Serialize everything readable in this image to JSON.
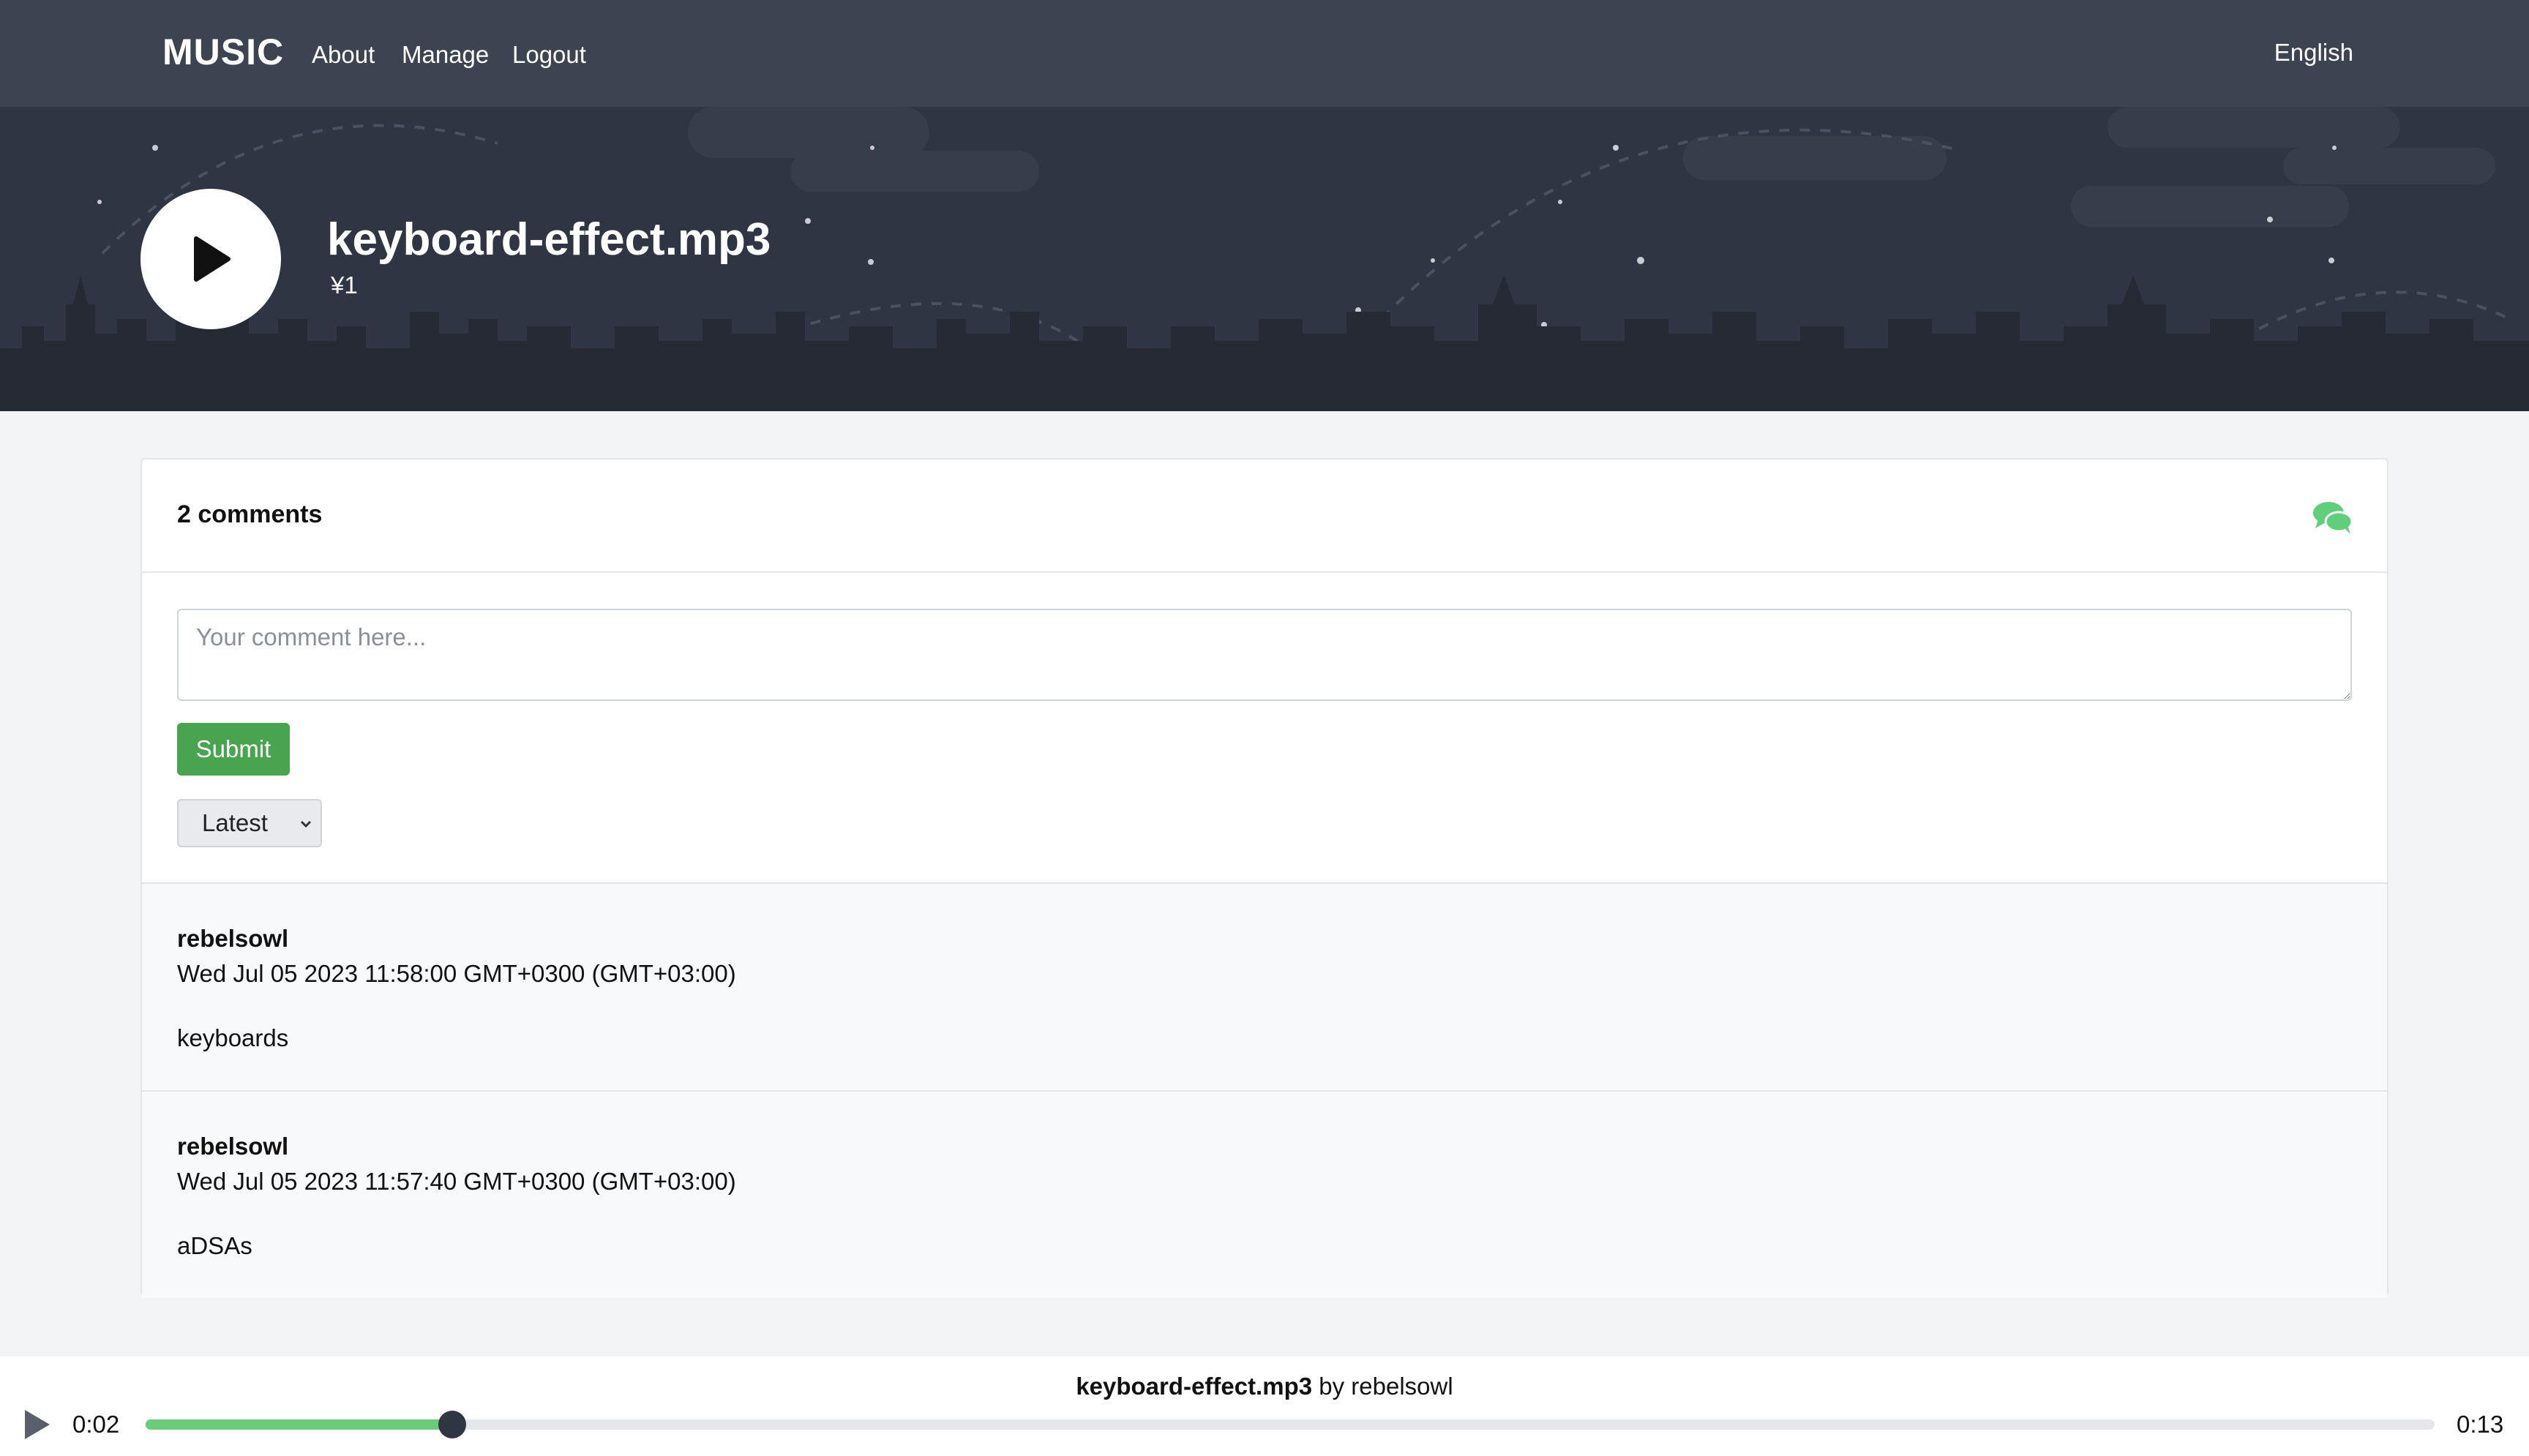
{
  "nav": {
    "brand": "MUSIC",
    "links": [
      "About",
      "Manage",
      "Logout"
    ],
    "language": "English"
  },
  "hero": {
    "title": "keyboard-effect.mp3",
    "price": "¥1"
  },
  "comments": {
    "count_label": "2 comments",
    "placeholder": "Your comment here...",
    "submit_label": "Submit",
    "sort_value": "Latest",
    "items": [
      {
        "user": "rebelsowl",
        "date": "Wed Jul 05 2023 11:58:00 GMT+0300 (GMT+03:00)",
        "text": "keyboards"
      },
      {
        "user": "rebelsowl",
        "date": "Wed Jul 05 2023 11:57:40 GMT+0300 (GMT+03:00)",
        "text": "aDSAs"
      }
    ]
  },
  "player": {
    "track": "keyboard-effect.mp3",
    "by": "by",
    "artist": "rebelsowl",
    "current_time": "0:02",
    "total_time": "0:13",
    "progress": 0.134
  },
  "colors": {
    "navbar": "#3d4451",
    "hero": "#2f3542",
    "accent_green": "#48a44e",
    "progress_green": "#6acb79",
    "comments_icon": "#5fcf7a"
  }
}
